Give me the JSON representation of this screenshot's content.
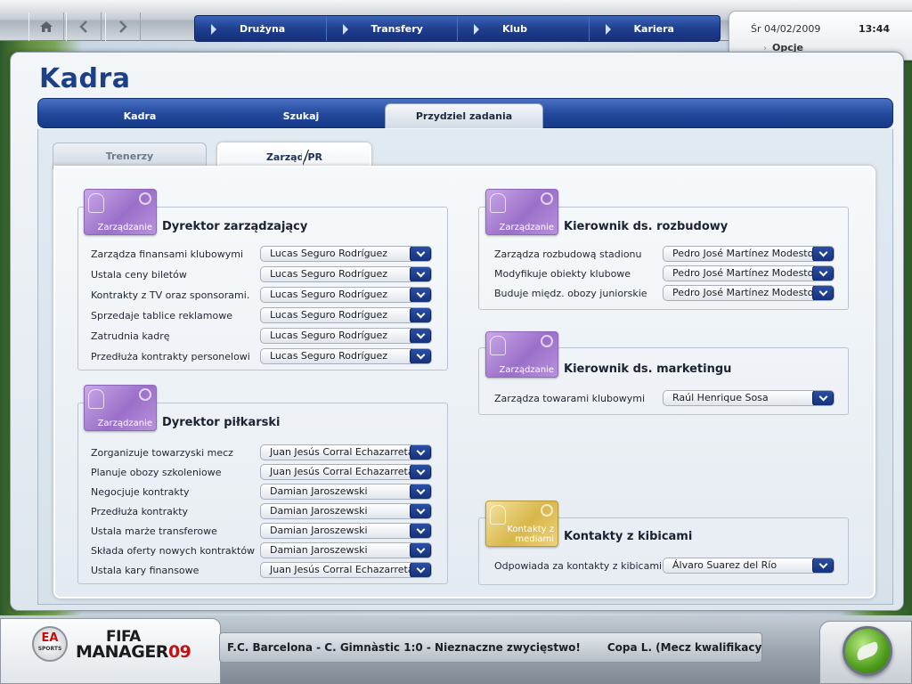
{
  "nav": {
    "items": [
      "Drużyna",
      "Transfery",
      "Klub",
      "Kariera"
    ]
  },
  "status": {
    "date": "Śr 04/02/2009",
    "time": "13:44",
    "options": "Opcje"
  },
  "page": {
    "title": "Kadra",
    "tabs": [
      "Kadra",
      "Szukaj",
      "Przydziel zadania"
    ],
    "subtabs": [
      "Trenerzy",
      "Zarząd/PR"
    ]
  },
  "groups": {
    "dyrektor_zarzadzajacy": {
      "icon_label": "Zarządzanie",
      "title": "Dyrektor zarządzający",
      "rows": [
        {
          "label": "Zarządza finansami klubowymi",
          "value": "Lucas Seguro Rodríguez"
        },
        {
          "label": "Ustala ceny biletów",
          "value": "Lucas Seguro Rodríguez"
        },
        {
          "label": "Kontrakty z TV oraz sponsorami.",
          "value": "Lucas Seguro Rodríguez"
        },
        {
          "label": "Sprzedaje tablice reklamowe",
          "value": "Lucas Seguro Rodríguez"
        },
        {
          "label": "Zatrudnia kadrę",
          "value": "Lucas Seguro Rodríguez"
        },
        {
          "label": "Przedłuża kontrakty personelowi",
          "value": "Lucas Seguro Rodríguez"
        }
      ]
    },
    "dyrektor_pilkarski": {
      "icon_label": "Zarządzanie",
      "title": "Dyrektor piłkarski",
      "rows": [
        {
          "label": "Zorganizuje towarzyski mecz",
          "value": "Juan Jesús Corral Echazarreta"
        },
        {
          "label": "Planuje obozy szkoleniowe",
          "value": "Juan Jesús Corral Echazarreta"
        },
        {
          "label": "Negocjuje kontrakty",
          "value": "Damian Jaroszewski"
        },
        {
          "label": "Przedłuża kontrakty",
          "value": "Damian Jaroszewski"
        },
        {
          "label": "Ustala marże transferowe",
          "value": "Damian Jaroszewski"
        },
        {
          "label": "Składa oferty nowych kontraktów",
          "value": "Damian Jaroszewski"
        },
        {
          "label": "Ustala kary finansowe",
          "value": "Juan Jesús Corral Echazarreta"
        }
      ]
    },
    "kierownik_rozbudowy": {
      "icon_label": "Zarządzanie",
      "title": "Kierownik ds. rozbudowy",
      "rows": [
        {
          "label": "Zarządza rozbudową stadionu",
          "value": "Pedro José Martínez Modesto"
        },
        {
          "label": "Modyfikuje obiekty klubowe",
          "value": "Pedro José Martínez Modesto"
        },
        {
          "label": "Buduje międz. obozy juniorskie",
          "value": "Pedro José Martínez Modesto"
        }
      ]
    },
    "kierownik_marketingu": {
      "icon_label": "Zarządzanie",
      "title": "Kierownik ds. marketingu",
      "rows": [
        {
          "label": "Zarządza towarami klubowymi",
          "value": "Raúl Henrique Sosa"
        }
      ]
    },
    "kontakty_kibice": {
      "icon_label": "Kontakty z mediami",
      "title": "Kontakty z kibicami",
      "rows": [
        {
          "label": "Odpowiada za kontakty z kibicami",
          "value": "Álvaro Suarez del Río"
        }
      ]
    }
  },
  "footer": {
    "ea": "EA",
    "ea_sub": "SPORTS",
    "fifa": "FIFA",
    "manager": "MANAGER",
    "manager_num": "09",
    "ticker": [
      "F.C. Barcelona - C. Gimnàstic 1:0 - Nieznaczne zwycięstwo!",
      "Copa L. (Mecz kwalifikacyj"
    ]
  },
  "icons": {
    "home": "home-icon",
    "back": "chevron-left-icon",
    "forward": "chevron-right-icon",
    "dropdown": "chevron-down-icon",
    "go": "continue-icon"
  }
}
